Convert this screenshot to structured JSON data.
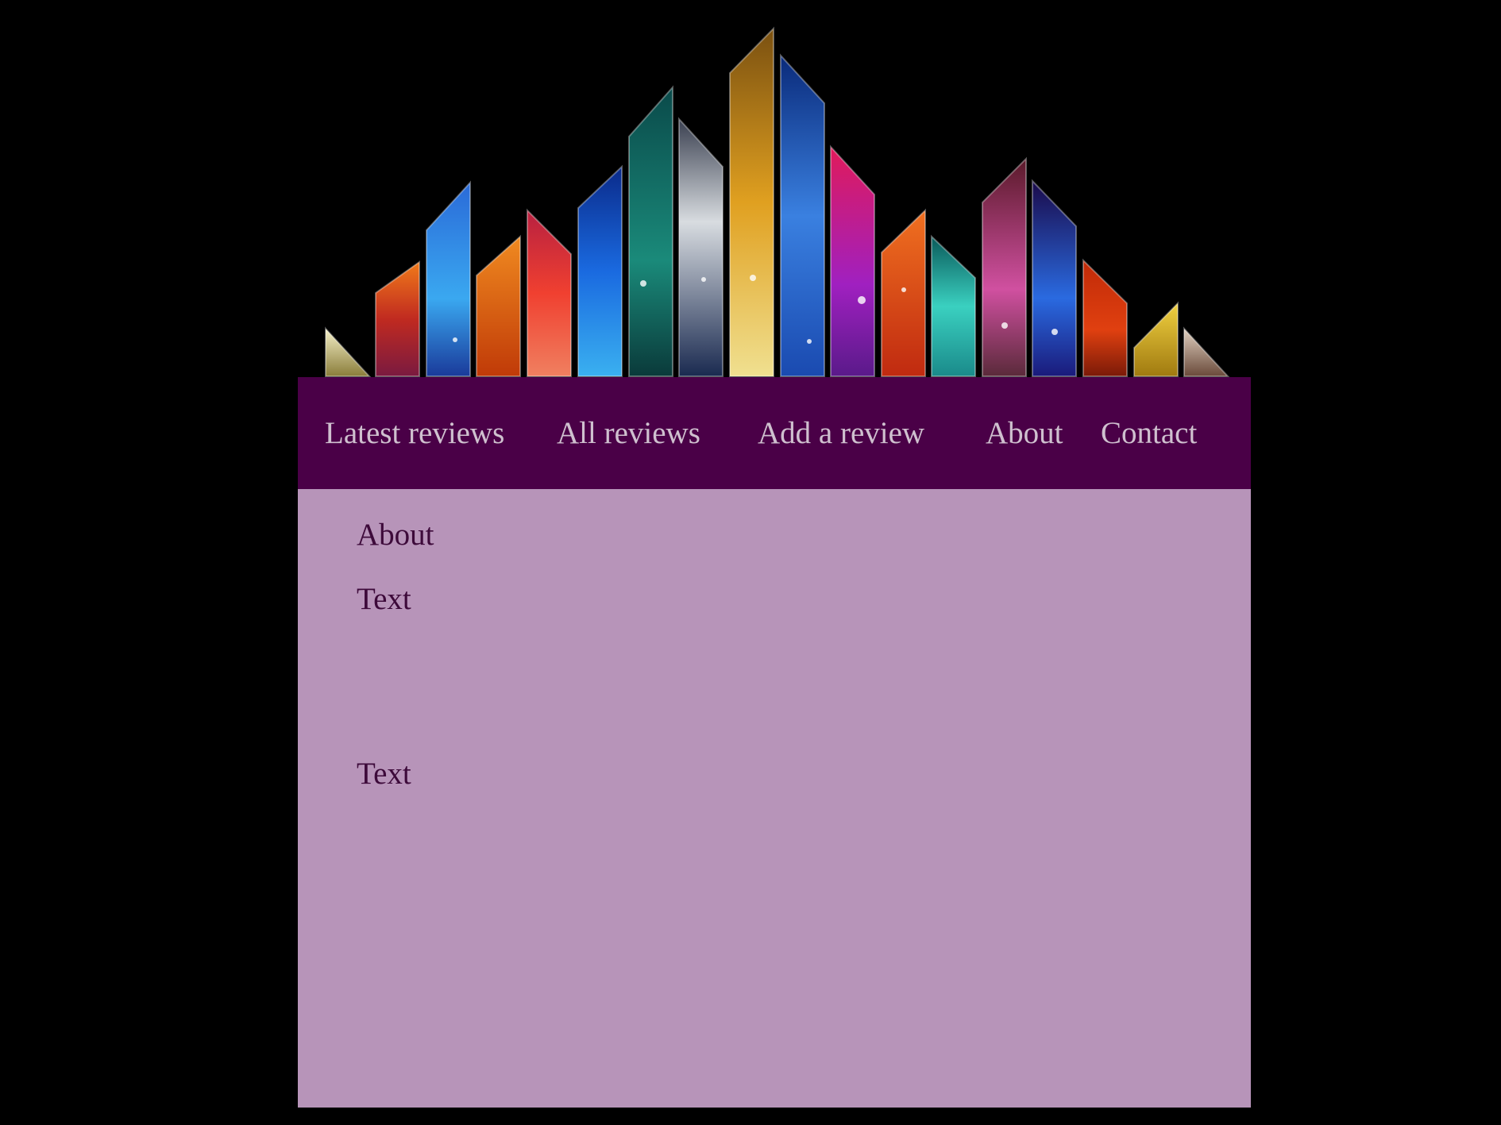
{
  "banner": {
    "background_color": "#000000"
  },
  "nav": {
    "background_color": "#4a0047",
    "text_color": "#cfc0cf",
    "items": [
      {
        "label": "Latest reviews"
      },
      {
        "label": "All reviews"
      },
      {
        "label": "Add a review"
      },
      {
        "label": "About"
      },
      {
        "label": "Contact"
      }
    ]
  },
  "content": {
    "background_color": "#b794b9",
    "text_color": "#3d0a3a",
    "title": "About",
    "sections": [
      {
        "label": "Text"
      },
      {
        "label": "Text"
      }
    ]
  }
}
